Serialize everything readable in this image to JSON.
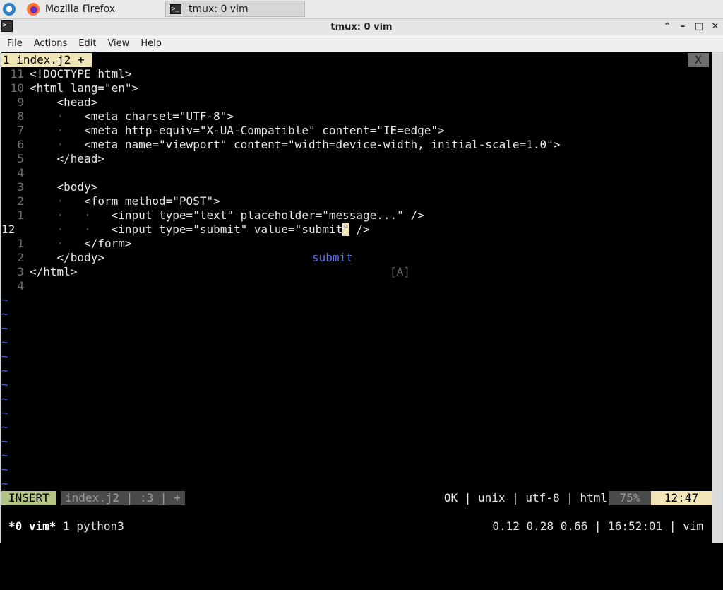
{
  "taskbar": {
    "firefox_label": "Mozilla Firefox",
    "tmux_label": "tmux: 0 vim"
  },
  "window": {
    "title": "tmux: 0 vim"
  },
  "menu": [
    "File",
    "Actions",
    "Edit",
    "View",
    "Help"
  ],
  "vim": {
    "tab_label": "1 index.j2 +",
    "tab_close": "X",
    "lines": [
      {
        "num": "11",
        "indent": "",
        "text": "<!DOCTYPE html>"
      },
      {
        "num": "10",
        "indent": "",
        "text": "<html lang=\"en\">"
      },
      {
        "num": "9",
        "indent": "    ",
        "text": "<head>"
      },
      {
        "num": "8",
        "indent": "    ·   ",
        "text": "<meta charset=\"UTF-8\">"
      },
      {
        "num": "7",
        "indent": "    ·   ",
        "text": "<meta http-equiv=\"X-UA-Compatible\" content=\"IE=edge\">"
      },
      {
        "num": "6",
        "indent": "    ·   ",
        "text": "<meta name=\"viewport\" content=\"width=device-width, initial-scale=1.0\">"
      },
      {
        "num": "5",
        "indent": "    ",
        "text": "</head>"
      },
      {
        "num": "4",
        "indent": "",
        "text": ""
      },
      {
        "num": "3",
        "indent": "    ",
        "text": "<body>"
      },
      {
        "num": "2",
        "indent": "    ·   ",
        "text": "<form method=\"POST\">"
      },
      {
        "num": "1",
        "indent": "    ·   ·   ",
        "text": "<input type=\"text\" placeholder=\"message...\" />"
      },
      {
        "num": "12",
        "indent": "    ·   ·   ",
        "text": "<input type=\"submit\" value=\"submit",
        "cursor_char": "\"",
        "after": " />",
        "current": true
      },
      {
        "num": "1",
        "indent": "    ·   ",
        "text": "</form>"
      },
      {
        "num": "2",
        "indent": "    ",
        "text": "</body>"
      },
      {
        "num": "3",
        "indent": "",
        "text": "</html>"
      },
      {
        "num": "4",
        "indent": "",
        "text": ""
      }
    ],
    "tilde": "~",
    "completion": {
      "item": "submit",
      "kind": "[A]"
    },
    "status": {
      "mode": "INSERT",
      "file": "index.j2 | :3 | +",
      "right": "OK | unix | utf-8 | html",
      "percent": "75%",
      "time": "12:47"
    }
  },
  "tmux": {
    "active_window": "*0 vim*",
    "other_window": " 1 python3",
    "right": "0.12 0.28 0.66 | 16:52:01 | vim"
  }
}
